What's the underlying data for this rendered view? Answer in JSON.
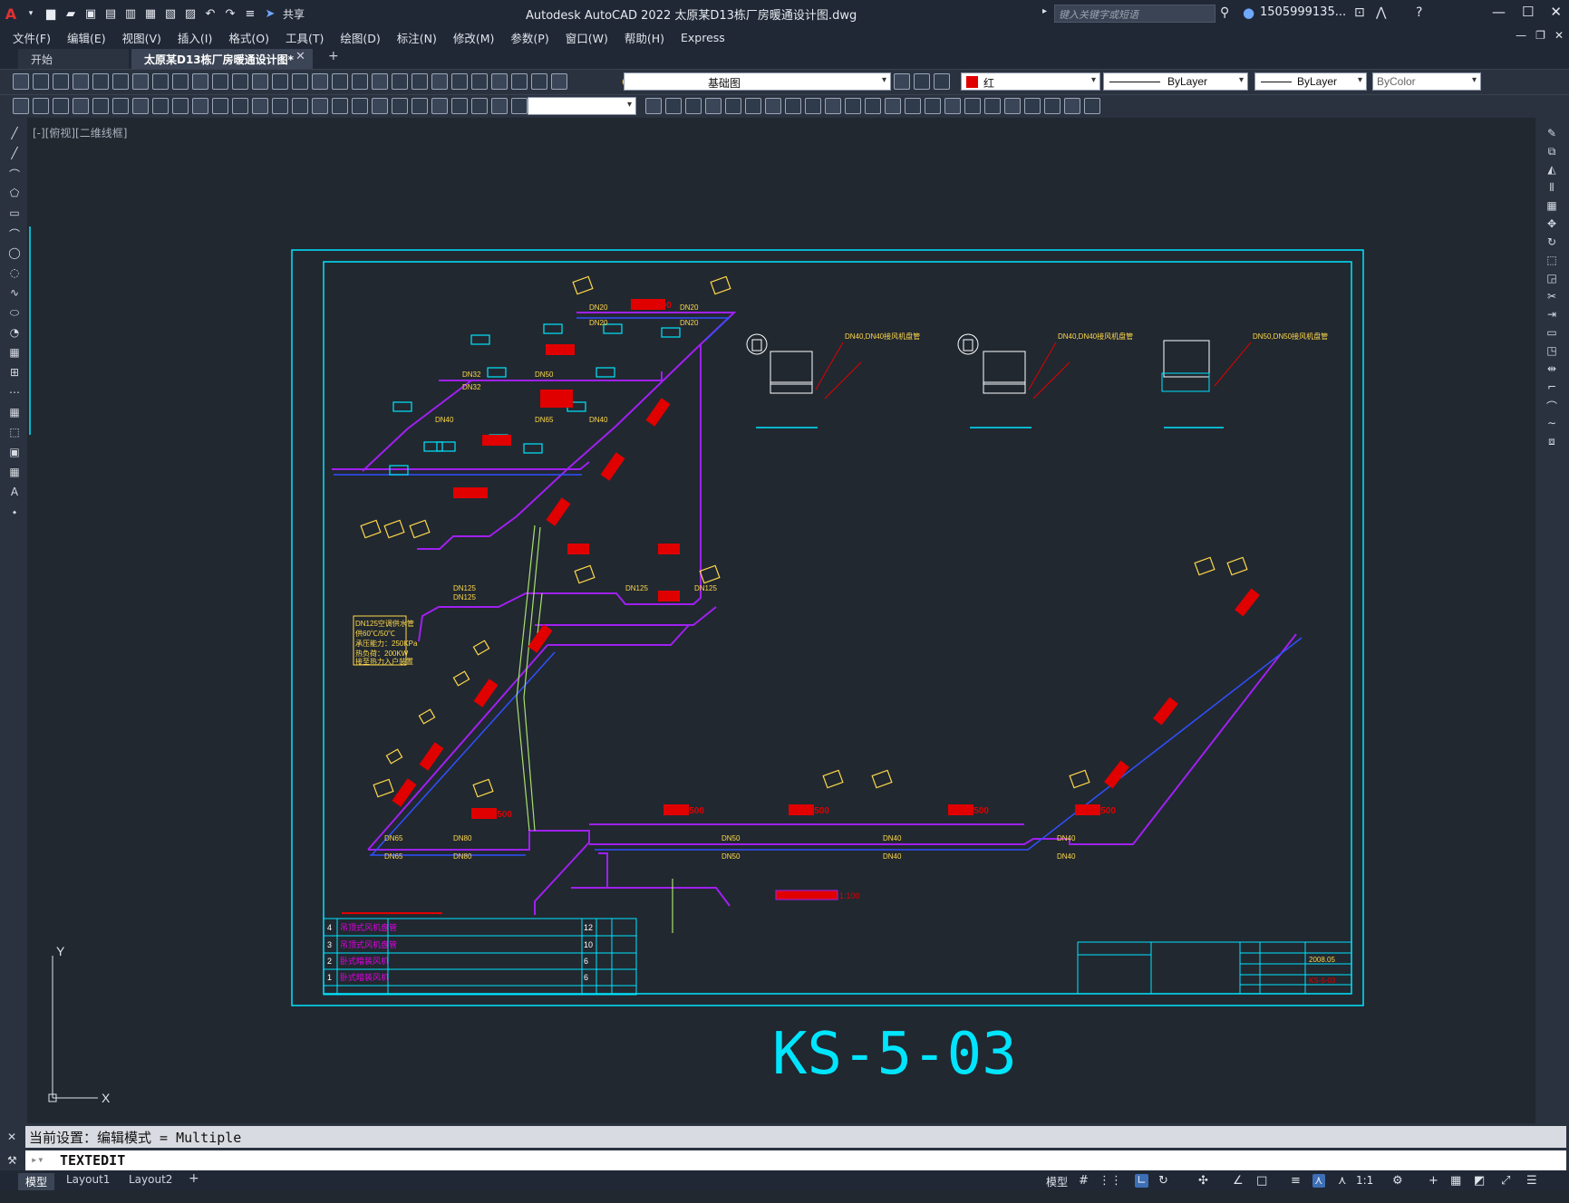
{
  "app": {
    "title": "Autodesk AutoCAD 2022    太原某D13栋厂房暖通设计图.dwg",
    "share_label": "共享",
    "search_placeholder": "键入关键字或短语",
    "user": "1505999135..."
  },
  "menus": [
    "文件(F)",
    "编辑(E)",
    "视图(V)",
    "插入(I)",
    "格式(O)",
    "工具(T)",
    "绘图(D)",
    "标注(N)",
    "修改(M)",
    "参数(P)",
    "窗口(W)",
    "帮助(H)",
    "Express"
  ],
  "tabs": {
    "start": "开始",
    "document": "太原某D13栋厂房暖通设计图*"
  },
  "toolbar": {
    "layer": "基础图",
    "color": "红",
    "linetype": "ByLayer",
    "lineweight": "ByLayer",
    "plotstyle": "ByColor",
    "colors": {
      "layer_swatch": "#00c000",
      "color_swatch": "#e00000"
    }
  },
  "viewport_label": "[-][俯视][二维线框]",
  "drawing": {
    "sheet_number": "KS-5-03",
    "pipe_labels": [
      "DN20",
      "DN20",
      "DN20",
      "DN20",
      "DN32",
      "DN32",
      "DN50",
      "DN65",
      "DN40",
      "DN40",
      "DN125",
      "DN125",
      "DN125",
      "DN125",
      "DN80",
      "DN80",
      "DN65",
      "DN65",
      "DN50",
      "DN50",
      "DN40",
      "DN40",
      "DN40",
      "DN40"
    ],
    "equipment_note": [
      "DN125空调供水管",
      "供60℃/50℃",
      "承压能力：250KPa",
      "热负荷：200KW",
      "接至热力入户装置"
    ],
    "detail_labels": [
      "DN40,DN40接风机盘管",
      "DN40,DN40接风机盘管",
      "DN50,DN50接风机盘管"
    ],
    "scale": "1:100",
    "elevation_labels": [
      "H=+3.500",
      "H=+3.500",
      "H=+3.500",
      "H=+3.500",
      "H=+3.500",
      "H=+3.500"
    ],
    "date": "2008.05",
    "drawing_no_small": "KS-5-03",
    "axis_x": "X",
    "axis_y": "Y",
    "table_rows": [
      {
        "no": "4",
        "name": "吊顶式风机盘管",
        "count": "12"
      },
      {
        "no": "3",
        "name": "吊顶式风机盘管",
        "count": "10"
      },
      {
        "no": "2",
        "name": "卧式暗装风机",
        "count": "6"
      },
      {
        "no": "1",
        "name": "卧式暗装风机",
        "count": "6"
      }
    ]
  },
  "command": {
    "history": "当前设置：编辑模式 = Multiple",
    "input": "TEXTEDIT"
  },
  "layouts": [
    "模型",
    "Layout1",
    "Layout2"
  ],
  "status": {
    "model": "模型",
    "scale": "1:1"
  }
}
